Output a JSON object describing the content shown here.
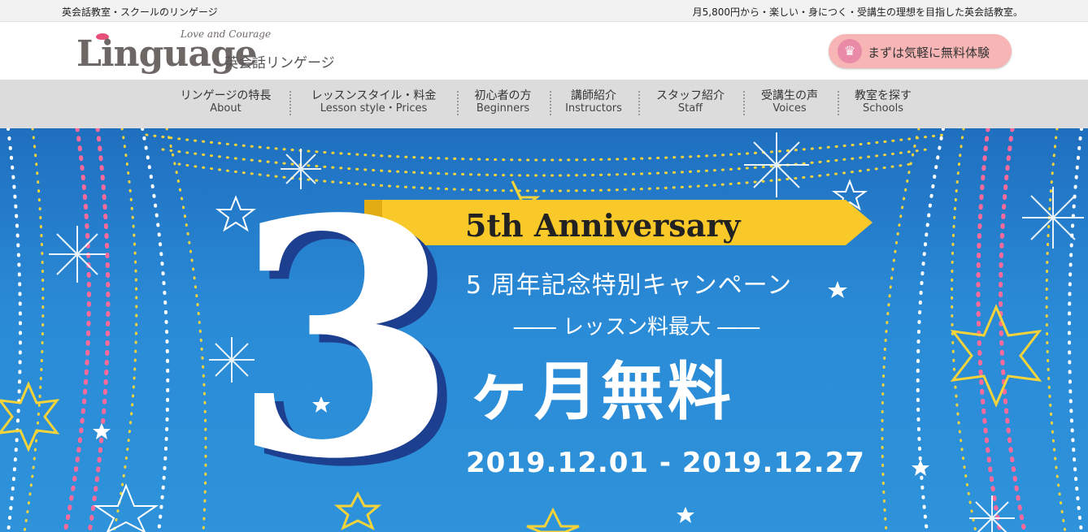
{
  "topbar": {
    "left_text": "英会話教室・スクールのリンゲージ",
    "right_text": "月5,800円から・楽しい・身につく・受講生の理想を目指した英会話教室。"
  },
  "header": {
    "logo_text": "Linguage",
    "logo_tagline": "Love and Courage",
    "logo_jp": "英会話リンゲージ",
    "cta_label": "まずは気軽に無料体験"
  },
  "nav": {
    "items": [
      {
        "jp": "リンゲージの特長",
        "en": "About"
      },
      {
        "jp": "レッスンスタイル・料金",
        "en": "Lesson style・Prices"
      },
      {
        "jp": "初心者の方",
        "en": "Beginners"
      },
      {
        "jp": "講師紹介",
        "en": "Instructors"
      },
      {
        "jp": "スタッフ紹介",
        "en": "Staff"
      },
      {
        "jp": "受講生の声",
        "en": "Voices"
      },
      {
        "jp": "教室を探す",
        "en": "Schools"
      }
    ]
  },
  "hero": {
    "big_number": "3",
    "anniversary": "5th Anniversary",
    "campaign": "5 周年記念特別キャンペーン",
    "lesson_line": "―― レッスン料最大 ――",
    "free": "ヶ月無料",
    "dates": "2019.12.01 - 2019.12.27"
  },
  "colors": {
    "hero_blue": "#2a8ad6",
    "ribbon_yellow": "#f8c928",
    "cta_pink": "#f7b5b5",
    "nav_gray": "#dcdcdc"
  }
}
